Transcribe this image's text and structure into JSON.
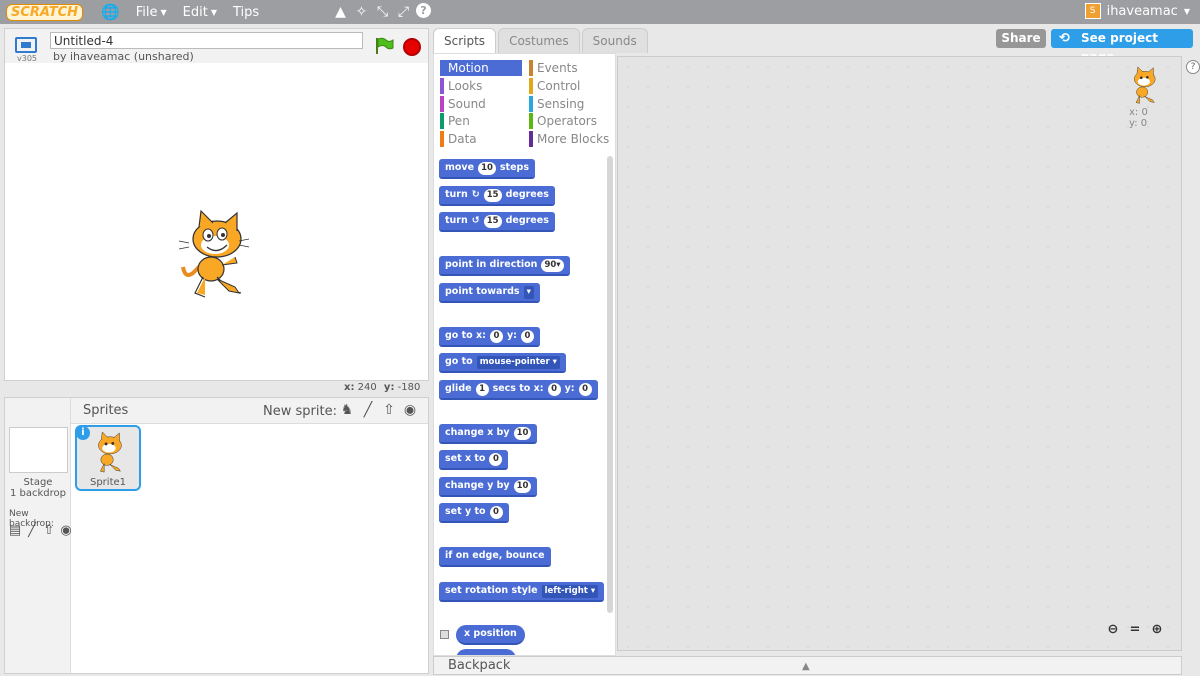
{
  "topbar": {
    "logo": "SCRATCH",
    "menus": [
      {
        "label": "File"
      },
      {
        "label": "Edit"
      },
      {
        "label": "Tips"
      }
    ],
    "username": "ihaveamac"
  },
  "stage": {
    "version": "v305",
    "project_title": "Untitled-4",
    "byline": "by ihaveamac (unshared)",
    "x_label": "x:",
    "x_value": "240",
    "y_label": "y:",
    "y_value": "-180"
  },
  "sprites_pane": {
    "title": "Sprites",
    "new_sprite_label": "New sprite:",
    "stage_label": "Stage",
    "stage_backdrops": "1 backdrop",
    "new_backdrop_label": "New backdrop:",
    "sprite1_name": "Sprite1"
  },
  "tabs": [
    {
      "label": "Scripts"
    },
    {
      "label": "Costumes"
    },
    {
      "label": "Sounds"
    }
  ],
  "buttons": {
    "share": "Share",
    "see_project": "See project page"
  },
  "categories": [
    {
      "label": "Motion",
      "color": "#4a6cd4"
    },
    {
      "label": "Looks",
      "color": "#8a55d7"
    },
    {
      "label": "Sound",
      "color": "#bb42c3"
    },
    {
      "label": "Pen",
      "color": "#0e9a6c"
    },
    {
      "label": "Data",
      "color": "#ee7d16"
    },
    {
      "label": "Events",
      "color": "#c88330"
    },
    {
      "label": "Control",
      "color": "#e1a91a"
    },
    {
      "label": "Sensing",
      "color": "#2ca5e2"
    },
    {
      "label": "Operators",
      "color": "#5cb712"
    },
    {
      "label": "More Blocks",
      "color": "#632d99"
    }
  ],
  "blocks": {
    "move": {
      "a": "move",
      "n": "10",
      "b": "steps"
    },
    "turn_right": {
      "a": "turn",
      "n": "15",
      "b": "degrees"
    },
    "turn_left": {
      "a": "turn",
      "n": "15",
      "b": "degrees"
    },
    "point_direction": {
      "a": "point in direction",
      "n": "90"
    },
    "point_towards": {
      "a": "point towards"
    },
    "goto_xy": {
      "a": "go to x:",
      "n1": "0",
      "b": "y:",
      "n2": "0"
    },
    "goto": {
      "a": "go to",
      "dd": "mouse-pointer"
    },
    "glide": {
      "a": "glide",
      "n1": "1",
      "b": "secs to x:",
      "n2": "0",
      "c": "y:",
      "n3": "0"
    },
    "change_x": {
      "a": "change x by",
      "n": "10"
    },
    "set_x": {
      "a": "set x to",
      "n": "0"
    },
    "change_y": {
      "a": "change y by",
      "n": "10"
    },
    "set_y": {
      "a": "set y to",
      "n": "0"
    },
    "bounce": {
      "a": "if on edge, bounce"
    },
    "rotation_style": {
      "a": "set rotation style",
      "dd": "left-right"
    },
    "x_position": {
      "a": "x position"
    }
  },
  "script_area": {
    "x_label": "x: 0",
    "y_label": "y: 0"
  },
  "backpack": {
    "label": "Backpack"
  }
}
